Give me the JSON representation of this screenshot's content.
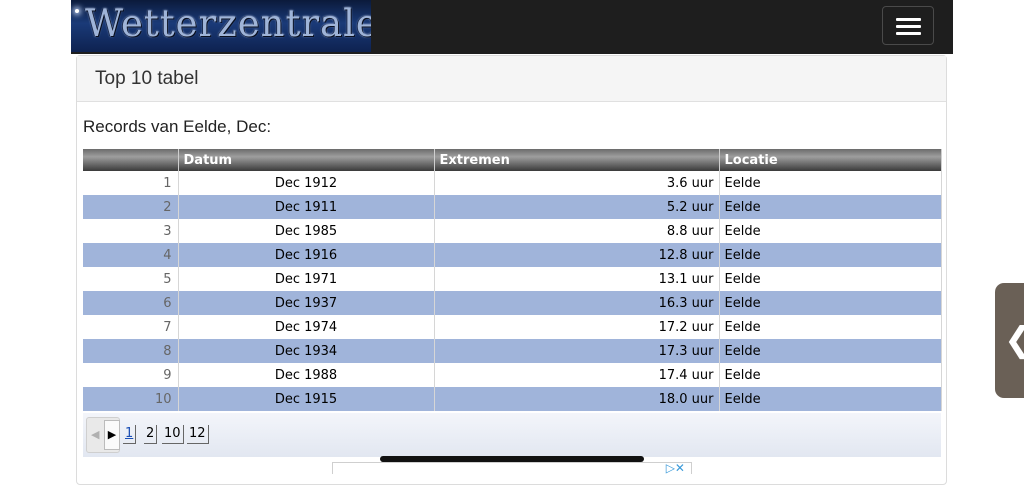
{
  "header": {
    "logo_text": "Wetterzentrale",
    "menu_icon": "hamburger-icon"
  },
  "panel": {
    "title": "Top 10 tabel",
    "subtitle": "Records van Eelde, Dec:"
  },
  "table": {
    "columns": [
      "",
      "Datum",
      "Extremen",
      "Locatie"
    ],
    "rows": [
      {
        "rank": "1",
        "datum": "Dec 1912",
        "extremen": "3.6 uur",
        "locatie": "Eelde"
      },
      {
        "rank": "2",
        "datum": "Dec 1911",
        "extremen": "5.2 uur",
        "locatie": "Eelde"
      },
      {
        "rank": "3",
        "datum": "Dec 1985",
        "extremen": "8.8 uur",
        "locatie": "Eelde"
      },
      {
        "rank": "4",
        "datum": "Dec 1916",
        "extremen": "12.8 uur",
        "locatie": "Eelde"
      },
      {
        "rank": "5",
        "datum": "Dec 1971",
        "extremen": "13.1 uur",
        "locatie": "Eelde"
      },
      {
        "rank": "6",
        "datum": "Dec 1937",
        "extremen": "16.3 uur",
        "locatie": "Eelde"
      },
      {
        "rank": "7",
        "datum": "Dec 1974",
        "extremen": "17.2 uur",
        "locatie": "Eelde"
      },
      {
        "rank": "8",
        "datum": "Dec 1934",
        "extremen": "17.3 uur",
        "locatie": "Eelde"
      },
      {
        "rank": "9",
        "datum": "Dec 1988",
        "extremen": "17.4 uur",
        "locatie": "Eelde"
      },
      {
        "rank": "10",
        "datum": "Dec 1915",
        "extremen": "18.0 uur",
        "locatie": "Eelde"
      }
    ]
  },
  "pager": {
    "prev_icon": "◀",
    "next_icon": "▶",
    "pages": [
      "1",
      "2",
      "10",
      "12"
    ],
    "active_page": "1"
  },
  "side_tab": {
    "icon": "❮"
  },
  "colors": {
    "row_alt": "#a0b4da",
    "header_bg": "#1e1e1e",
    "link": "#1b4fb5"
  }
}
